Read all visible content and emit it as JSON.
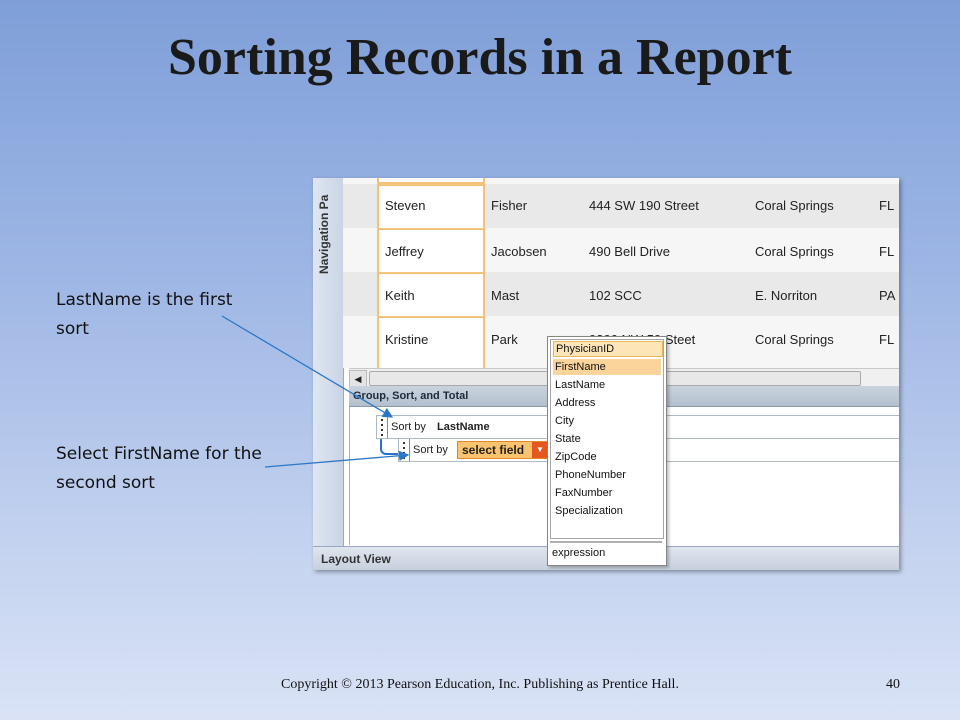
{
  "slide": {
    "title": "Sorting Records in a Report",
    "callouts": [
      "LastName is the first sort",
      "Select FirstName for the second sort"
    ],
    "footer": "Copyright © 2013 Pearson Education, Inc. Publishing as Prentice Hall.",
    "page_number": "40"
  },
  "screenshot": {
    "nav_pane_label": "Navigation Pa",
    "rows": [
      {
        "first": "Steven",
        "last": "Fisher",
        "address": "444 SW 190 Street",
        "city": "Coral Springs",
        "state": "FL"
      },
      {
        "first": "Jeffrey",
        "last": "Jacobsen",
        "address": "490 Bell Drive",
        "city": "Coral Springs",
        "state": "FL"
      },
      {
        "first": "Keith",
        "last": "Mast",
        "address": "102 SCC",
        "city": "E. Norriton",
        "state": "PA"
      },
      {
        "first": "Kristine",
        "last": "Park",
        "address": "9300 NW 59 Steet",
        "city": "Coral Springs",
        "state": "FL"
      }
    ],
    "group_sort_total": {
      "header": "Group, Sort, and Total",
      "sort1": {
        "label": "Sort by",
        "value": "LastName"
      },
      "sort2": {
        "label": "Sort by",
        "value": "select field"
      }
    },
    "field_list": [
      "PhysicianID",
      "FirstName",
      "LastName",
      "Address",
      "City",
      "State",
      "ZipCode",
      "PhoneNumber",
      "FaxNumber",
      "Specialization"
    ],
    "field_list_expression": "expression",
    "status_bar": "Layout View",
    "colors": {
      "accent_orange": "#f9c36f",
      "dropdown_button": "#e4571f",
      "selection_blue": "#2c6ed4"
    }
  }
}
